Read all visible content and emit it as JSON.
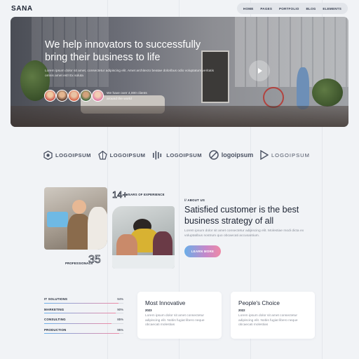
{
  "header": {
    "brand": "SANA",
    "nav": [
      "HOME",
      "PAGES",
      "PORTFOLIO",
      "BLOG",
      "ELEMENTS"
    ]
  },
  "hero": {
    "title": "We help innovators to successfully bring their business to life",
    "description": "Lorem ipsum dolor sit amet, consectetur adipiscing elit. Amet architecto beatae doloribus odio voluptatum veritatis omnis amet est! Ex soluta",
    "clients_text": "We have over 4,000 clients around the world"
  },
  "logos": [
    "LOGOIPSUM",
    "LOGOIPSUM",
    "LOGOIPSUM",
    "logoipsum",
    "LOGOIPSUM"
  ],
  "about": {
    "experience_number": "14+",
    "experience_label": "YEARS OF EXPERIENCE",
    "professionals_label": "PROFESSIONALS",
    "professionals_number": "35",
    "tag": "// ABOUT US",
    "title": "Satisfied customer is the best business strategy of all",
    "description": "Lorem ipsum dolor sit amet consectetur adipiscing elit. Molestiae modi dicta ex voluptatibus nostrum quo obcaecati accusantium.",
    "button": "LEARN MORE"
  },
  "skills": [
    {
      "name": "IT SOLUTIONS",
      "percent": "94%",
      "value": 0.94
    },
    {
      "name": "MARKETING",
      "percent": "90%",
      "value": 0.9
    },
    {
      "name": "CONSULTING",
      "percent": "85%",
      "value": 0.85
    },
    {
      "name": "PRODUCTION",
      "percent": "95%",
      "value": 0.95
    }
  ],
  "cards": [
    {
      "title": "Most Innovative",
      "year": "2023",
      "description": "Lorem ipsum dolor sit amet consectetur adipiscing elit. Nobis fugiat libero neque obcaecati molestias"
    },
    {
      "title": "People's Choice",
      "year": "2022",
      "description": "Lorem ipsum dolor sit amet consectetur adipiscing elit. Nobis fugiat libero neque obcaecati molestias"
    }
  ],
  "colors": {
    "background": "#f1f3f6",
    "text": "#1d2433",
    "muted": "#8a8f9a",
    "gradient_start": "#6aaee8",
    "gradient_end": "#ee8aa6"
  }
}
